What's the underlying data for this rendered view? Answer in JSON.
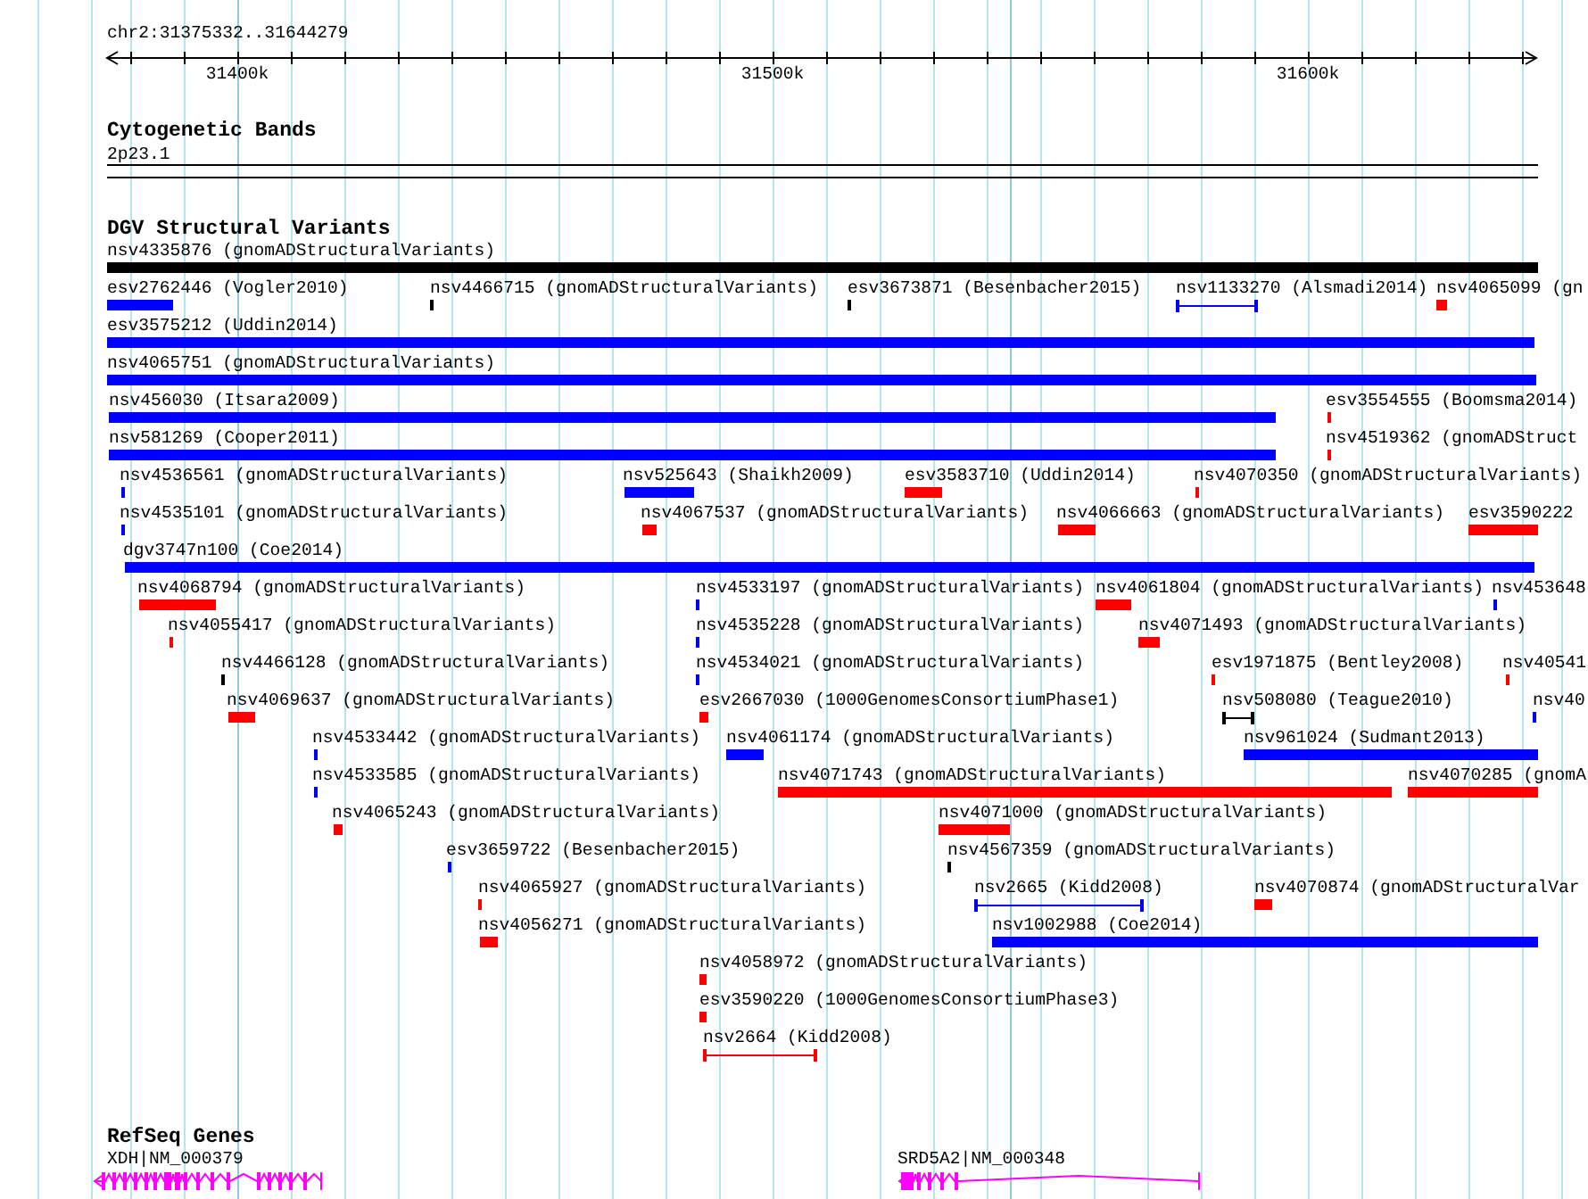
{
  "ruler": {
    "location": "chr2:31375332..31644279",
    "ticks": [
      "31400k",
      "31500k",
      "31600k"
    ]
  },
  "tracks": [
    {
      "kind": "bands",
      "title": "Cytogenetic Bands",
      "features": [
        {
          "label": "2p23.1"
        }
      ]
    },
    {
      "kind": "variants",
      "title": "DGV Structural Variants",
      "features": [
        {
          "label": "nsv4335876 (gnomADStructuralVariants)",
          "color": "#000000",
          "kind": "bar"
        },
        {
          "label": "esv2762446 (Vogler2010)",
          "color": "#0000ff",
          "kind": "bar"
        },
        {
          "label": "nsv4466715 (gnomADStructuralVariants)",
          "color": "#000000",
          "kind": "bar"
        },
        {
          "label": "esv3673871 (Besenbacher2015)",
          "color": "#000000",
          "kind": "bar"
        },
        {
          "label": "nsv1133270 (Alsmadi2014)",
          "color": "#0000ff",
          "kind": "span"
        },
        {
          "label": "nsv4065099 (gn",
          "color": "#ff0000",
          "kind": "bar"
        },
        {
          "label": "esv3575212 (Uddin2014)",
          "color": "#0000ff",
          "kind": "bar"
        },
        {
          "label": "nsv4065751 (gnomADStructuralVariants)",
          "color": "#0000ff",
          "kind": "bar"
        },
        {
          "label": "nsv456030 (Itsara2009)",
          "color": "#0000ff",
          "kind": "bar"
        },
        {
          "label": "esv3554555 (Boomsma2014)",
          "color": "#ff0000",
          "kind": "bar"
        },
        {
          "label": "nsv581269 (Cooper2011)",
          "color": "#0000ff",
          "kind": "bar"
        },
        {
          "label": "nsv4519362 (gnomADStruct",
          "color": "#ff0000",
          "kind": "bar"
        },
        {
          "label": "nsv4536561 (gnomADStructuralVariants)",
          "color": "#0000ff",
          "kind": "bar"
        },
        {
          "label": "nsv525643 (Shaikh2009)",
          "color": "#0000ff",
          "kind": "bar"
        },
        {
          "label": "esv3583710 (Uddin2014)",
          "color": "#ff0000",
          "kind": "bar"
        },
        {
          "label": "nsv4070350 (gnomADStructuralVariants)",
          "color": "#ff0000",
          "kind": "bar"
        },
        {
          "label": "nsv4535101 (gnomADStructuralVariants)",
          "color": "#0000ff",
          "kind": "bar"
        },
        {
          "label": "nsv4067537 (gnomADStructuralVariants)",
          "color": "#ff0000",
          "kind": "bar"
        },
        {
          "label": "nsv4066663 (gnomADStructuralVariants)",
          "color": "#ff0000",
          "kind": "bar"
        },
        {
          "label": "esv3590222",
          "color": "#ff0000",
          "kind": "bar"
        },
        {
          "label": "dgv3747n100 (Coe2014)",
          "color": "#0000ff",
          "kind": "bar"
        },
        {
          "label": "nsv4068794 (gnomADStructuralVariants)",
          "color": "#ff0000",
          "kind": "bar"
        },
        {
          "label": "nsv4533197 (gnomADStructuralVariants)",
          "color": "#0000ff",
          "kind": "bar"
        },
        {
          "label": "nsv4061804 (gnomADStructuralVariants)",
          "color": "#ff0000",
          "kind": "bar"
        },
        {
          "label": "nsv453648",
          "color": "#0000ff",
          "kind": "bar"
        },
        {
          "label": "nsv4055417 (gnomADStructuralVariants)",
          "color": "#ff0000",
          "kind": "bar"
        },
        {
          "label": "nsv4535228 (gnomADStructuralVariants)",
          "color": "#0000ff",
          "kind": "bar"
        },
        {
          "label": "nsv4071493 (gnomADStructuralVariants)",
          "color": "#ff0000",
          "kind": "bar"
        },
        {
          "label": "nsv4466128 (gnomADStructuralVariants)",
          "color": "#000000",
          "kind": "bar"
        },
        {
          "label": "nsv4534021 (gnomADStructuralVariants)",
          "color": "#0000ff",
          "kind": "bar"
        },
        {
          "label": "esv1971875 (Bentley2008)",
          "color": "#ff0000",
          "kind": "bar"
        },
        {
          "label": "nsv40541",
          "color": "#ff0000",
          "kind": "bar"
        },
        {
          "label": "nsv4069637 (gnomADStructuralVariants)",
          "color": "#ff0000",
          "kind": "bar"
        },
        {
          "label": "esv2667030 (1000GenomesConsortiumPhase1)",
          "color": "#ff0000",
          "kind": "bar"
        },
        {
          "label": "nsv508080 (Teague2010)",
          "color": "#000000",
          "kind": "span"
        },
        {
          "label": "nsv40",
          "color": "#0000ff",
          "kind": "bar"
        },
        {
          "label": "nsv4533442 (gnomADStructuralVariants)",
          "color": "#0000ff",
          "kind": "bar"
        },
        {
          "label": "nsv4061174 (gnomADStructuralVariants)",
          "color": "#0000ff",
          "kind": "bar"
        },
        {
          "label": "nsv961024 (Sudmant2013)",
          "color": "#0000ff",
          "kind": "bar"
        },
        {
          "label": "nsv4533585 (gnomADStructuralVariants)",
          "color": "#0000ff",
          "kind": "bar"
        },
        {
          "label": "nsv4071743 (gnomADStructuralVariants)",
          "color": "#ff0000",
          "kind": "bar"
        },
        {
          "label": "nsv4070285 (gnomA",
          "color": "#ff0000",
          "kind": "bar"
        },
        {
          "label": "nsv4065243 (gnomADStructuralVariants)",
          "color": "#ff0000",
          "kind": "bar"
        },
        {
          "label": "nsv4071000 (gnomADStructuralVariants)",
          "color": "#ff0000",
          "kind": "bar"
        },
        {
          "label": "esv3659722 (Besenbacher2015)",
          "color": "#0000ff",
          "kind": "bar"
        },
        {
          "label": "nsv4567359 (gnomADStructuralVariants)",
          "color": "#000000",
          "kind": "bar"
        },
        {
          "label": "nsv4065927 (gnomADStructuralVariants)",
          "color": "#ff0000",
          "kind": "bar"
        },
        {
          "label": "nsv2665 (Kidd2008)",
          "color": "#0000ff",
          "kind": "span"
        },
        {
          "label": "nsv4070874 (gnomADStructuralVar",
          "color": "#ff0000",
          "kind": "bar"
        },
        {
          "label": "nsv4056271 (gnomADStructuralVariants)",
          "color": "#ff0000",
          "kind": "bar"
        },
        {
          "label": "nsv1002988 (Coe2014)",
          "color": "#0000ff",
          "kind": "bar"
        },
        {
          "label": "nsv4058972 (gnomADStructuralVariants)",
          "color": "#ff0000",
          "kind": "bar"
        },
        {
          "label": "esv3590220 (1000GenomesConsortiumPhase3)",
          "color": "#ff0000",
          "kind": "bar"
        },
        {
          "label": "nsv2664 (Kidd2008)",
          "color": "#ff0000",
          "kind": "span"
        }
      ]
    },
    {
      "kind": "genes",
      "title": "RefSeq Genes",
      "features": [
        {
          "label": "XDH|NM_000379"
        },
        {
          "label": "SRD5A2|NM_000348"
        }
      ]
    }
  ]
}
